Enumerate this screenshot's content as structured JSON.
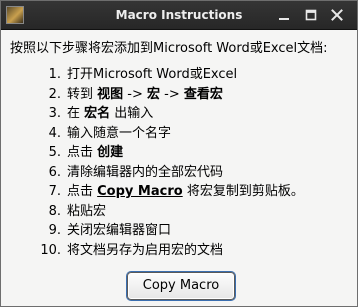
{
  "window": {
    "title": "Macro Instructions",
    "icon": "app-icon"
  },
  "heading": "按照以下步骤将宏添加到Microsoft Word或Excel文档:",
  "steps": [
    {
      "num": "1.",
      "parts": [
        {
          "text": "打开Microsoft Word或Excel",
          "style": "normal"
        }
      ]
    },
    {
      "num": "2.",
      "parts": [
        {
          "text": "转到 ",
          "style": "normal"
        },
        {
          "text": "视图",
          "style": "bold"
        },
        {
          "text": " -> ",
          "style": "normal"
        },
        {
          "text": "宏",
          "style": "bold"
        },
        {
          "text": " -> ",
          "style": "normal"
        },
        {
          "text": "查看宏",
          "style": "bold"
        }
      ]
    },
    {
      "num": "3.",
      "parts": [
        {
          "text": "在 ",
          "style": "normal"
        },
        {
          "text": "宏名",
          "style": "bold"
        },
        {
          "text": " 出输入",
          "style": "normal"
        }
      ]
    },
    {
      "num": "4.",
      "parts": [
        {
          "text": "输入随意一个名字",
          "style": "normal"
        }
      ]
    },
    {
      "num": "5.",
      "parts": [
        {
          "text": "点击 ",
          "style": "normal"
        },
        {
          "text": "创建",
          "style": "bold"
        }
      ]
    },
    {
      "num": "6.",
      "parts": [
        {
          "text": "清除编辑器内的全部宏代码",
          "style": "normal"
        }
      ]
    },
    {
      "num": "7.",
      "parts": [
        {
          "text": "点击 ",
          "style": "normal"
        },
        {
          "text": "Copy Macro",
          "style": "link"
        },
        {
          "text": " 将宏复制到剪贴板。",
          "style": "normal"
        }
      ]
    },
    {
      "num": "8.",
      "parts": [
        {
          "text": "粘贴宏",
          "style": "normal"
        }
      ]
    },
    {
      "num": "9.",
      "parts": [
        {
          "text": "关闭宏编辑器窗口",
          "style": "normal"
        }
      ]
    },
    {
      "num": "10.",
      "parts": [
        {
          "text": "将文档另存为启用宏的文档",
          "style": "normal"
        }
      ]
    }
  ],
  "button": {
    "label": "Copy Macro"
  },
  "titlebar_buttons": {
    "minimize": "minimize-icon",
    "maximize": "maximize-icon",
    "close": "close-icon"
  }
}
